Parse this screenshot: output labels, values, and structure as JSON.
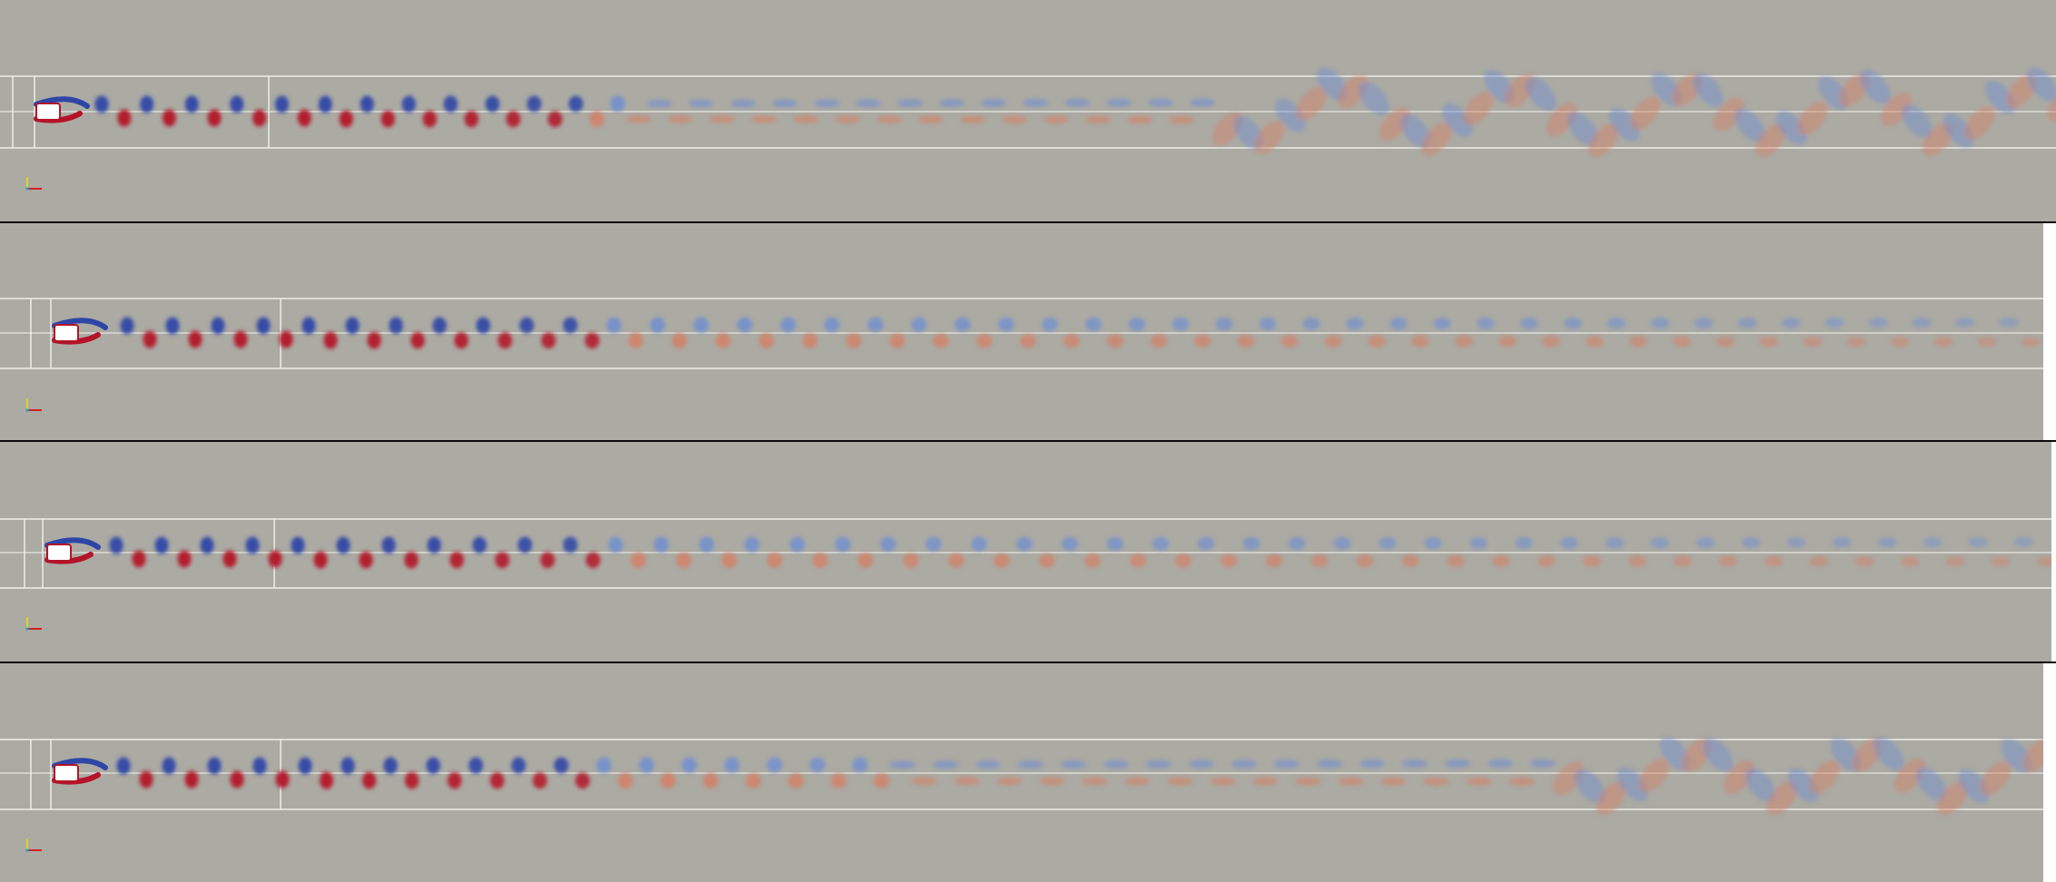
{
  "scene": {
    "background_color": "#abaaa3",
    "separator_color": "#0a0a0a",
    "vortex_negative_color": "#2f46a6",
    "vortex_positive_color": "#b31429",
    "wake_negative_color": "#6f8ed0",
    "wake_positive_color": "#d48066",
    "guide_line_color": "#f2f2ee"
  },
  "panels": [
    {
      "name": "view-1",
      "wake_regime": "shed-then-meander"
    },
    {
      "name": "view-2",
      "wake_regime": "steady-street"
    },
    {
      "name": "view-3",
      "wake_regime": "steady-street"
    },
    {
      "name": "view-4",
      "wake_regime": "shed-then-meander"
    }
  ],
  "orientation_axes": {
    "icon": "xyz-axes-triad-icon",
    "x_color": "#d62020",
    "y_color": "#d6d620",
    "z_color": "#20a0d6"
  }
}
